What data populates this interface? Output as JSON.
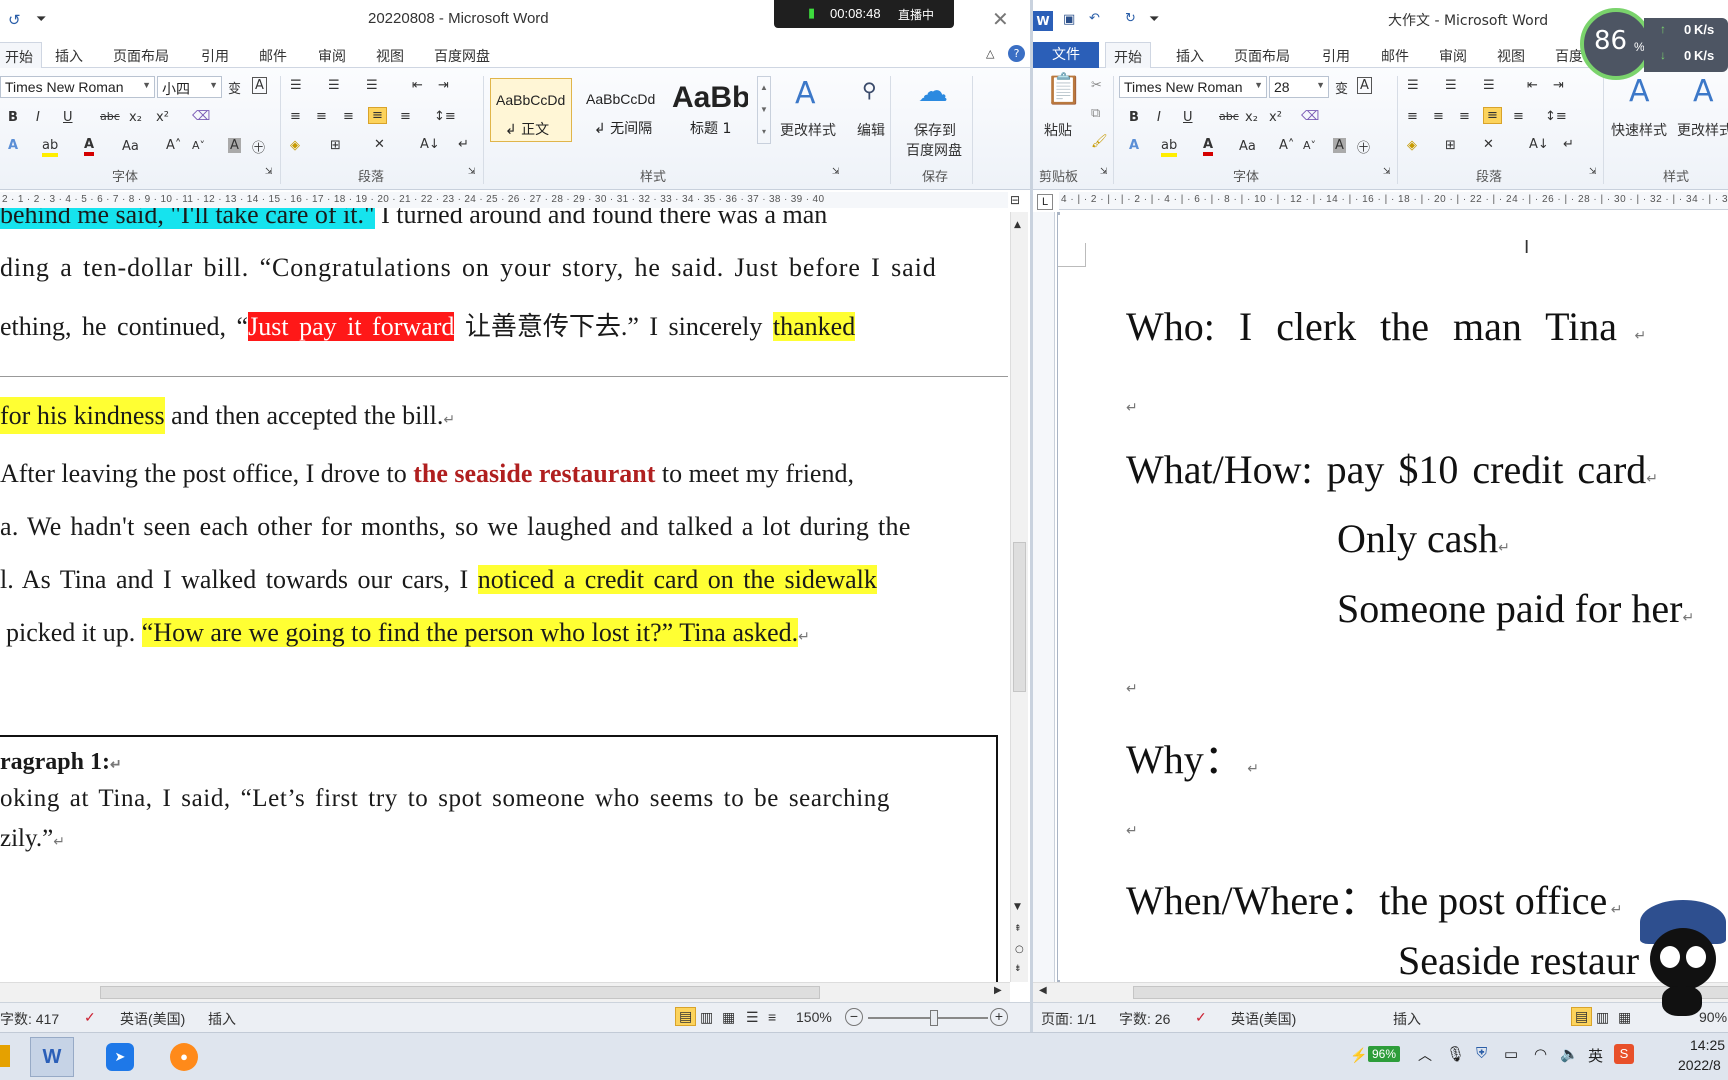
{
  "left_window": {
    "title": "20220808 - Microsoft Word",
    "tabs": [
      "开始",
      "插入",
      "页面布局",
      "引用",
      "邮件",
      "审阅",
      "视图",
      "百度网盘"
    ],
    "font_name": "Times New Roman",
    "font_size": "小四",
    "styles": [
      {
        "preview": "AaBbCcDd",
        "name": "↲ 正文"
      },
      {
        "preview": "AaBbCcDd",
        "name": "↲ 无间隔"
      },
      {
        "preview": "AaBb",
        "name": "标题 1"
      }
    ],
    "buttons": {
      "change_styles": "更改样式",
      "edit": "编辑",
      "save_to": "保存到",
      "baidu": "百度网盘"
    },
    "groups": [
      "字体",
      "段落",
      "样式",
      "保存"
    ],
    "ruler": "2 · 1 · 2 · 3 · 4 · 5 · 6 · 7 · 8 · 9 · 10 · 11 · 12 · 13 · 14 · 15 · 16 · 17 · 18 · 19 · 20 · 21 · 22 · 23 · 24 · 25 · 26 · 27 · 28 · 29 · 30 · 31 · 32 · 33 · 34 · 35 · 36 · 37 · 38 · 39 · 40",
    "doc": {
      "l1_a": "behind me said, \"I'll take care of it.\"",
      "l1_b": " I turned around and found there was a man",
      "l2": "ding a ten-dollar bill. “Congratulations on your story, he said. Just before I said",
      "l3_a": "ething, he continued, “",
      "l3_b": "Just pay it forward",
      "l3_c": " 让善意传下去.” I sincerely ",
      "l3_d": "thanked",
      "l4_a": " for his kindness",
      "l4_b": " and then accepted the bill.",
      "l5_a": " After leaving the post office, I drove to ",
      "l5_b": "the seaside restaurant",
      "l5_c": " to meet my friend,",
      "l6": "a. We hadn't seen each other for months, so we laughed and talked a lot during the",
      "l7_a": "l. As Tina and I walked towards our cars, I ",
      "l7_b": "noticed a credit card on the sidewalk",
      "l8_a": "picked it up. ",
      "l8_b": "“How are we going to find the person who lost it?” Tina asked.",
      "box_title": "ragraph  1:",
      "box_l1": "oking at Tina, I said, “Let’s first try to spot someone who seems to be searching",
      "box_l2": "zily.”"
    },
    "status": {
      "words": "字数: 417",
      "lang": "英语(美国)",
      "mode": "插入",
      "zoom": "150%"
    }
  },
  "recording": {
    "time": "00:08:48",
    "label": "直播中"
  },
  "right_window": {
    "title": "大作文 - Microsoft Word",
    "tabs": [
      "文件",
      "开始",
      "插入",
      "页面布局",
      "引用",
      "邮件",
      "审阅",
      "视图",
      "百度"
    ],
    "font_name": "Times New Roman",
    "font_size": "28",
    "paste": "粘贴",
    "quick_styles": "快速样式",
    "change_styles": "更改样式",
    "groups": [
      "剪贴板",
      "字体",
      "段落",
      "样式"
    ],
    "ruler": "4 · | · 2 · | · | · 2 · | · 4 · | · 6 · | · 8 · | · 10 · | · 12 · | · 14 · | · 16 · | · 18 · | · 20 · | · 22 · | · 24 · | · 26 · | · 28 · | · 30 · | · 32 · | · 34 · | · 36",
    "doc": {
      "who": "Who: I    clerk    the man    Tina",
      "what": "What/How: pay $10    credit card",
      "only_cash": "Only cash",
      "someone": "Someone paid for her",
      "why": "Why：",
      "when": "When/Where：the post office",
      "seaside": "Seaside restaur"
    },
    "status": {
      "page": "页面: 1/1",
      "words": "字数: 26",
      "lang": "英语(美国)",
      "mode": "插入",
      "zoom": "90%"
    }
  },
  "net_widget": {
    "percent": "86",
    "unit": "%",
    "up": "0",
    "down": "0",
    "rate_unit": "K/s"
  },
  "taskbar": {
    "battery": "96%",
    "ime": "英",
    "time": "14:25",
    "date": "2022/8"
  }
}
